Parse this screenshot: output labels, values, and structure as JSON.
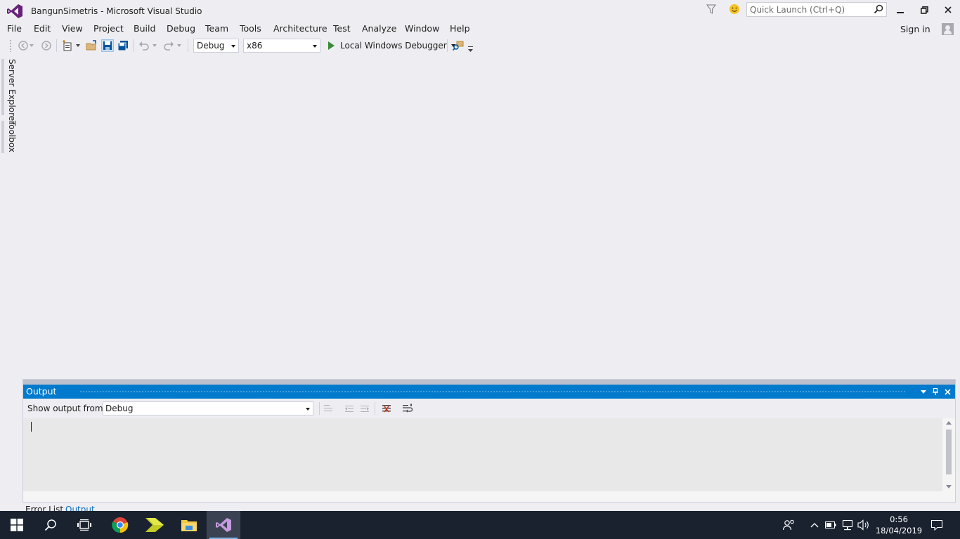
{
  "window": {
    "title": "BangunSimetris - Microsoft Visual Studio",
    "quick_launch_placeholder": "Quick Launch (Ctrl+Q)"
  },
  "menu": {
    "items": [
      "File",
      "Edit",
      "View",
      "Project",
      "Build",
      "Debug",
      "Team",
      "Tools",
      "Architecture",
      "Test",
      "Analyze",
      "Window",
      "Help"
    ],
    "sign_in": "Sign in"
  },
  "toolbar": {
    "config": "Debug",
    "platform": "x86",
    "debugger": "Local Windows Debugger"
  },
  "side_tabs": [
    "Server Explorer",
    "Toolbox"
  ],
  "output": {
    "title": "Output",
    "show_from_label": "Show output from:",
    "show_from_value": "Debug",
    "tabs": [
      "Error List",
      "Output"
    ]
  },
  "taskbar": {
    "time": "0:56",
    "date": "18/04/2019"
  },
  "colors": {
    "accent": "#007acc",
    "chrome": "#eeeef2",
    "vs_purple": "#68217a",
    "taskbar": "#1a2230"
  }
}
